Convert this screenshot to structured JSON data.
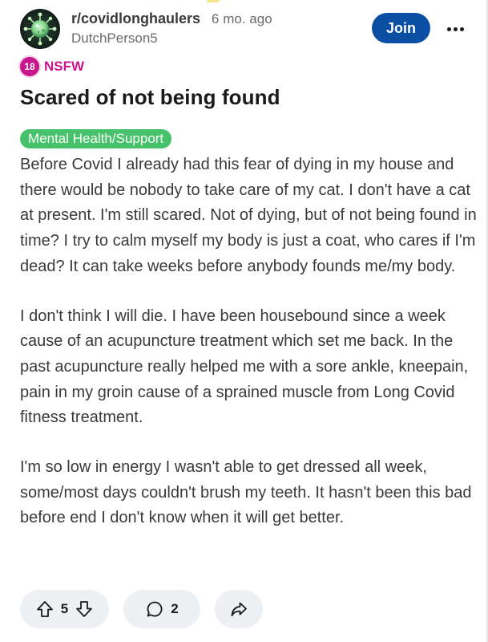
{
  "post": {
    "subreddit": "r/covidlonghaulers",
    "age": "6 mo. ago",
    "author": "DutchPerson5",
    "join_label": "Join",
    "nsfw_badge": "18",
    "nsfw_label": "NSFW",
    "title": "Scared of not being found",
    "flair": "Mental Health/Support",
    "paragraphs": [
      "Before Covid I already had this fear of dying in my house and there would be nobody to take care of my cat. I don't have a cat at present. I'm still scared. Not of dying, but of not being found in time? I try to calm myself my body is just a coat, who cares if I'm dead? It can take weeks before anybody founds me/my body.",
      "I don't think I will die. I have been housebound since a week cause of an acupuncture treatment which set me back. In the past acupuncture really helped me with a sore ankle, kneepain, pain in my groin cause of a sprained muscle from Long Covid fitness treatment.",
      "I'm so low in energy I wasn't able to get dressed all week, some/most days couldn't brush my teeth. It hasn't been this bad before end I don't know when it will get better."
    ],
    "votes": "5",
    "comments": "2"
  },
  "icons": {
    "avatar": "subreddit-avatar-virus",
    "upvote": "upvote-arrow-icon",
    "downvote": "downvote-arrow-icon",
    "comment": "comment-bubble-icon",
    "share": "share-arrow-icon",
    "more": "more-dots-icon"
  },
  "colors": {
    "join_button": "#0a4fa3",
    "nsfw": "#c8168c",
    "flair": "#46c26b",
    "action_pill": "#eef1f3"
  }
}
